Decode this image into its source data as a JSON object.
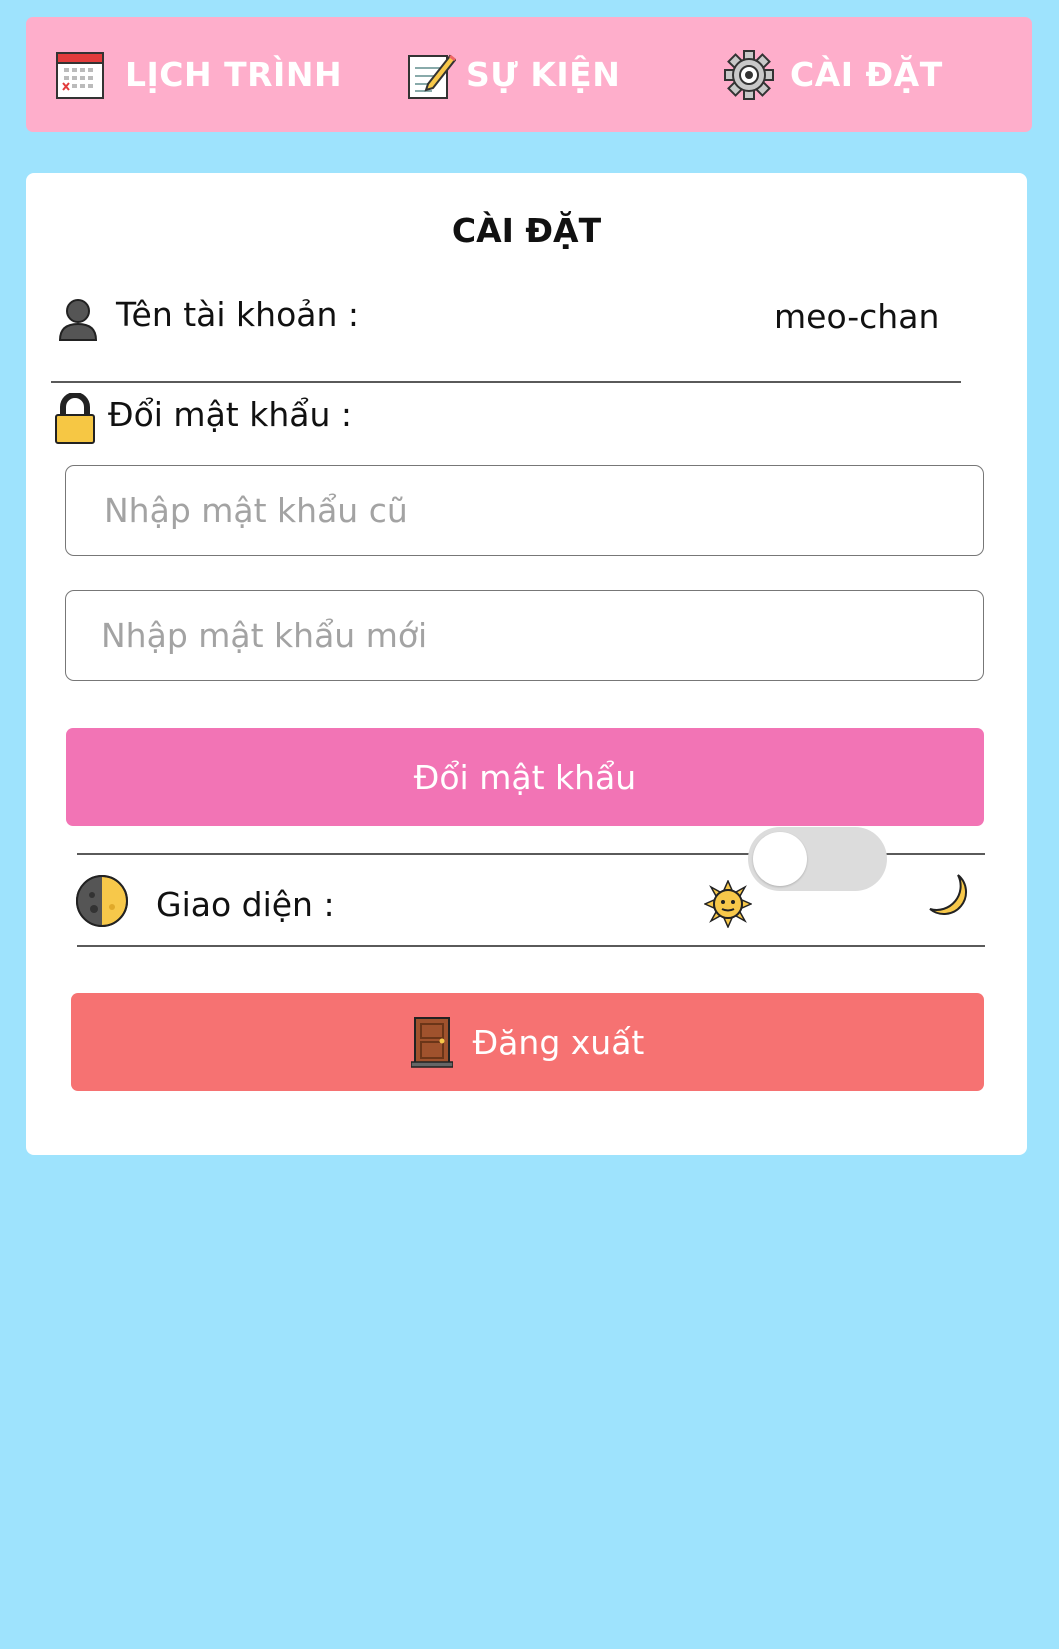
{
  "nav": {
    "items": [
      {
        "label": "LỊCH  TRÌNH",
        "icon": "calendar-icon"
      },
      {
        "label": "SỰ KIỆN",
        "icon": "notepad-icon"
      },
      {
        "label": "CÀI ĐẶT",
        "icon": "gear-icon"
      }
    ]
  },
  "settings": {
    "title": "CÀI ĐẶT",
    "account": {
      "label": "Tên tài khoản :",
      "value": "meo-chan",
      "icon": "user-icon"
    },
    "password": {
      "label": "Đổi mật khẩu :",
      "icon": "lock-icon",
      "old_placeholder": "Nhập mật khẩu cũ",
      "new_placeholder": "Nhập mật khẩu mới",
      "button_label": "Đổi mật khẩu"
    },
    "theme": {
      "label": "Giao diện :",
      "icon": "half-moon-icon",
      "left_icon": "sun-icon",
      "right_icon": "crescent-moon-icon",
      "dark_mode": false
    },
    "logout": {
      "label": "Đăng xuất",
      "icon": "door-icon"
    }
  },
  "colors": {
    "background": "#9ee3fd",
    "nav": "#feaecb",
    "change_button": "#f274b5",
    "logout_button": "#f67272"
  }
}
